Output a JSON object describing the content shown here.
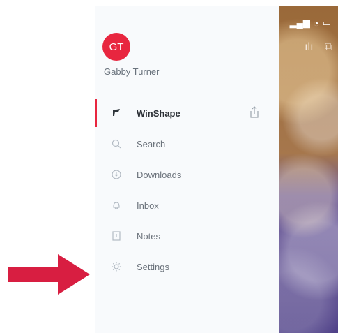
{
  "profile": {
    "initials": "GT",
    "name": "Gabby Turner"
  },
  "menu": {
    "items": [
      {
        "label": "WinShape",
        "icon": "flag-icon"
      },
      {
        "label": "Search",
        "icon": "search-icon"
      },
      {
        "label": "Downloads",
        "icon": "downloads-icon"
      },
      {
        "label": "Inbox",
        "icon": "bell-icon"
      },
      {
        "label": "Notes",
        "icon": "notes-icon"
      },
      {
        "label": "Settings",
        "icon": "gear-icon"
      }
    ]
  },
  "colors": {
    "accent": "#e8263f",
    "arrow": "#d81e41"
  },
  "icons": {
    "share": "share-icon",
    "stats": "bar-chart-icon",
    "chat": "chat-icon"
  }
}
